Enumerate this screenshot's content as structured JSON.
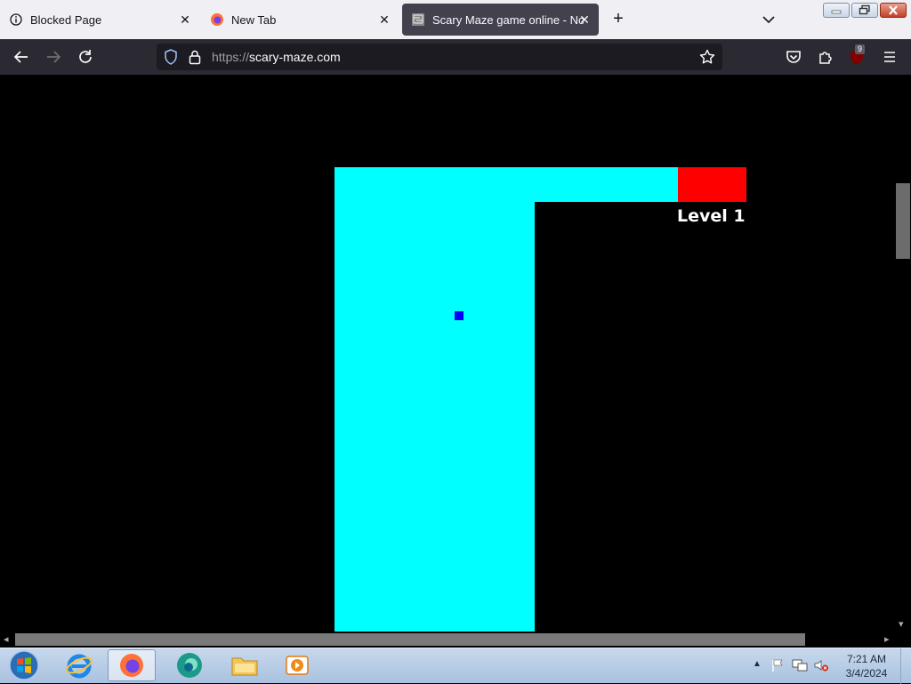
{
  "tabs": [
    {
      "title": "Blocked Page",
      "icon": "info-icon"
    },
    {
      "title": "New Tab",
      "icon": "firefox-icon"
    },
    {
      "title": "Scary Maze game online - No d",
      "icon": "maze-favicon",
      "active": true
    }
  ],
  "navbar": {
    "url_scheme": "https://",
    "url_host": "scary-maze.com",
    "extension_badge": "9"
  },
  "game": {
    "level_label": "Level 1",
    "colors": {
      "path": "#00ffff",
      "goal": "#ff0000",
      "player": "#0000ff",
      "background": "#000000"
    }
  },
  "taskbar": {
    "pinned": [
      "start-orb",
      "internet-explorer",
      "firefox",
      "edge",
      "file-explorer",
      "media-player"
    ],
    "clock_time": "7:21 AM",
    "clock_date": "3/4/2024"
  }
}
